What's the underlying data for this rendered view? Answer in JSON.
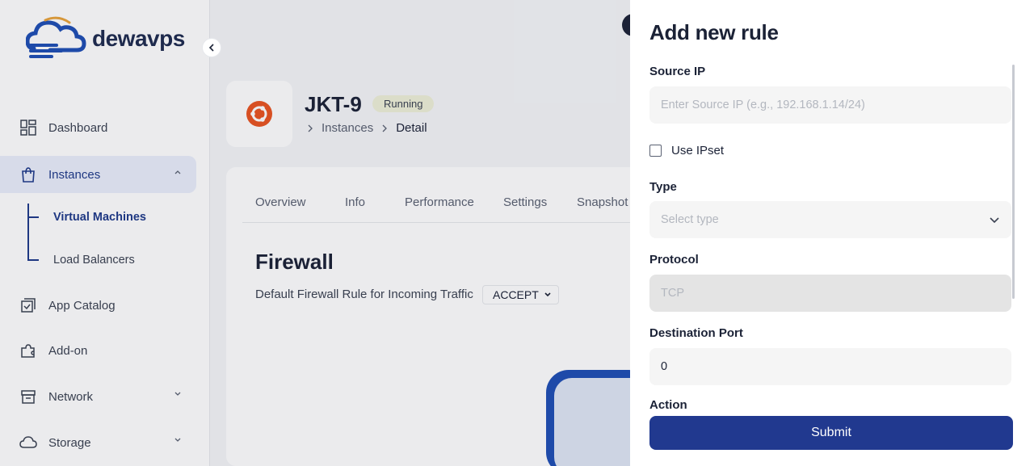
{
  "brand": {
    "name": "dewavps"
  },
  "sidebar": {
    "items": [
      {
        "label": "Dashboard",
        "icon": "dashboard-icon"
      },
      {
        "label": "Instances",
        "icon": "instances-icon"
      },
      {
        "label": "App Catalog",
        "icon": "app-catalog-icon"
      },
      {
        "label": "Add-on",
        "icon": "puzzle-icon"
      },
      {
        "label": "Network",
        "icon": "network-icon"
      },
      {
        "label": "Storage",
        "icon": "cloud-icon"
      }
    ],
    "sub_items": [
      {
        "label": "Virtual Machines"
      },
      {
        "label": "Load Balancers"
      }
    ]
  },
  "instance": {
    "name": "JKT-9",
    "status": "Running",
    "breadcrumb": [
      "Instances",
      "Detail"
    ]
  },
  "tabs": [
    {
      "label": "Overview"
    },
    {
      "label": "Info"
    },
    {
      "label": "Performance"
    },
    {
      "label": "Settings"
    },
    {
      "label": "Snapshot"
    }
  ],
  "firewall": {
    "title": "Firewall",
    "default_label": "Default Firewall Rule for Incoming Traffic",
    "default_value": "ACCEPT"
  },
  "drawer": {
    "title": "Add new rule",
    "source_ip": {
      "label": "Source IP",
      "placeholder": "Enter Source IP (e.g., 192.168.1.14/24)"
    },
    "use_ipset": {
      "label": "Use IPset"
    },
    "type": {
      "label": "Type",
      "placeholder": "Select type"
    },
    "protocol": {
      "label": "Protocol",
      "value": "TCP"
    },
    "destination_port": {
      "label": "Destination Port",
      "value": "0"
    },
    "action": {
      "label": "Action"
    },
    "submit_label": "Submit"
  },
  "colors": {
    "primary": "#21398f",
    "active_nav_bg": "#e9eefb",
    "ubuntu": "#e95420"
  }
}
